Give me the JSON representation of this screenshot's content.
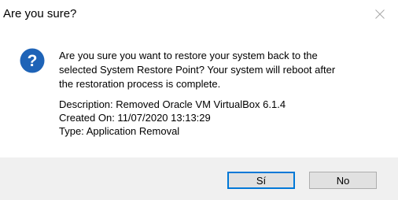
{
  "window": {
    "title": "Are you sure?",
    "close_icon": "close-icon"
  },
  "message": {
    "icon": "question-icon",
    "icon_color": "#1e63b7",
    "lines": [
      "Are you sure you want to restore your system back to the",
      "selected System Restore Point?  Your system will reboot after",
      "the restoration process is complete."
    ]
  },
  "details": {
    "description": "Description: Removed Oracle VM VirtualBox 6.1.4",
    "created_on": "Created On: 11/07/2020 13:13:29",
    "type": "Type: Application Removal"
  },
  "buttons": {
    "yes_label": "Sí",
    "no_label": "No",
    "default_accent": "#0078d7"
  }
}
